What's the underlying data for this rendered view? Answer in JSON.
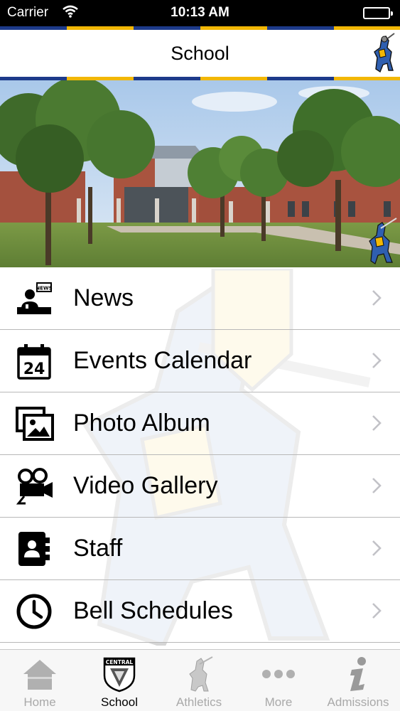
{
  "status_bar": {
    "carrier": "Carrier",
    "time": "10:13 AM"
  },
  "navbar": {
    "title": "School"
  },
  "menu": {
    "items": [
      {
        "label": "News",
        "icon": "news-icon"
      },
      {
        "label": "Events Calendar",
        "icon": "calendar-icon"
      },
      {
        "label": "Photo Album",
        "icon": "photo-album-icon"
      },
      {
        "label": "Video Gallery",
        "icon": "video-camera-icon"
      },
      {
        "label": "Staff",
        "icon": "contacts-book-icon"
      },
      {
        "label": "Bell Schedules",
        "icon": "clock-icon"
      }
    ]
  },
  "tabbar": {
    "tabs": [
      {
        "label": "Home",
        "icon": "house-icon",
        "active": false
      },
      {
        "label": "School",
        "icon": "central-shield-icon",
        "badge_text": "CENTRAL",
        "active": true
      },
      {
        "label": "Athletics",
        "icon": "knight-icon",
        "active": false
      },
      {
        "label": "More",
        "icon": "more-dots-icon",
        "active": false
      },
      {
        "label": "Admissions",
        "icon": "info-icon",
        "active": false
      }
    ]
  },
  "colors": {
    "stripe_blue": "#1d3a8a",
    "stripe_gold": "#f2b705",
    "inactive_tab": "#a9a9a9"
  }
}
